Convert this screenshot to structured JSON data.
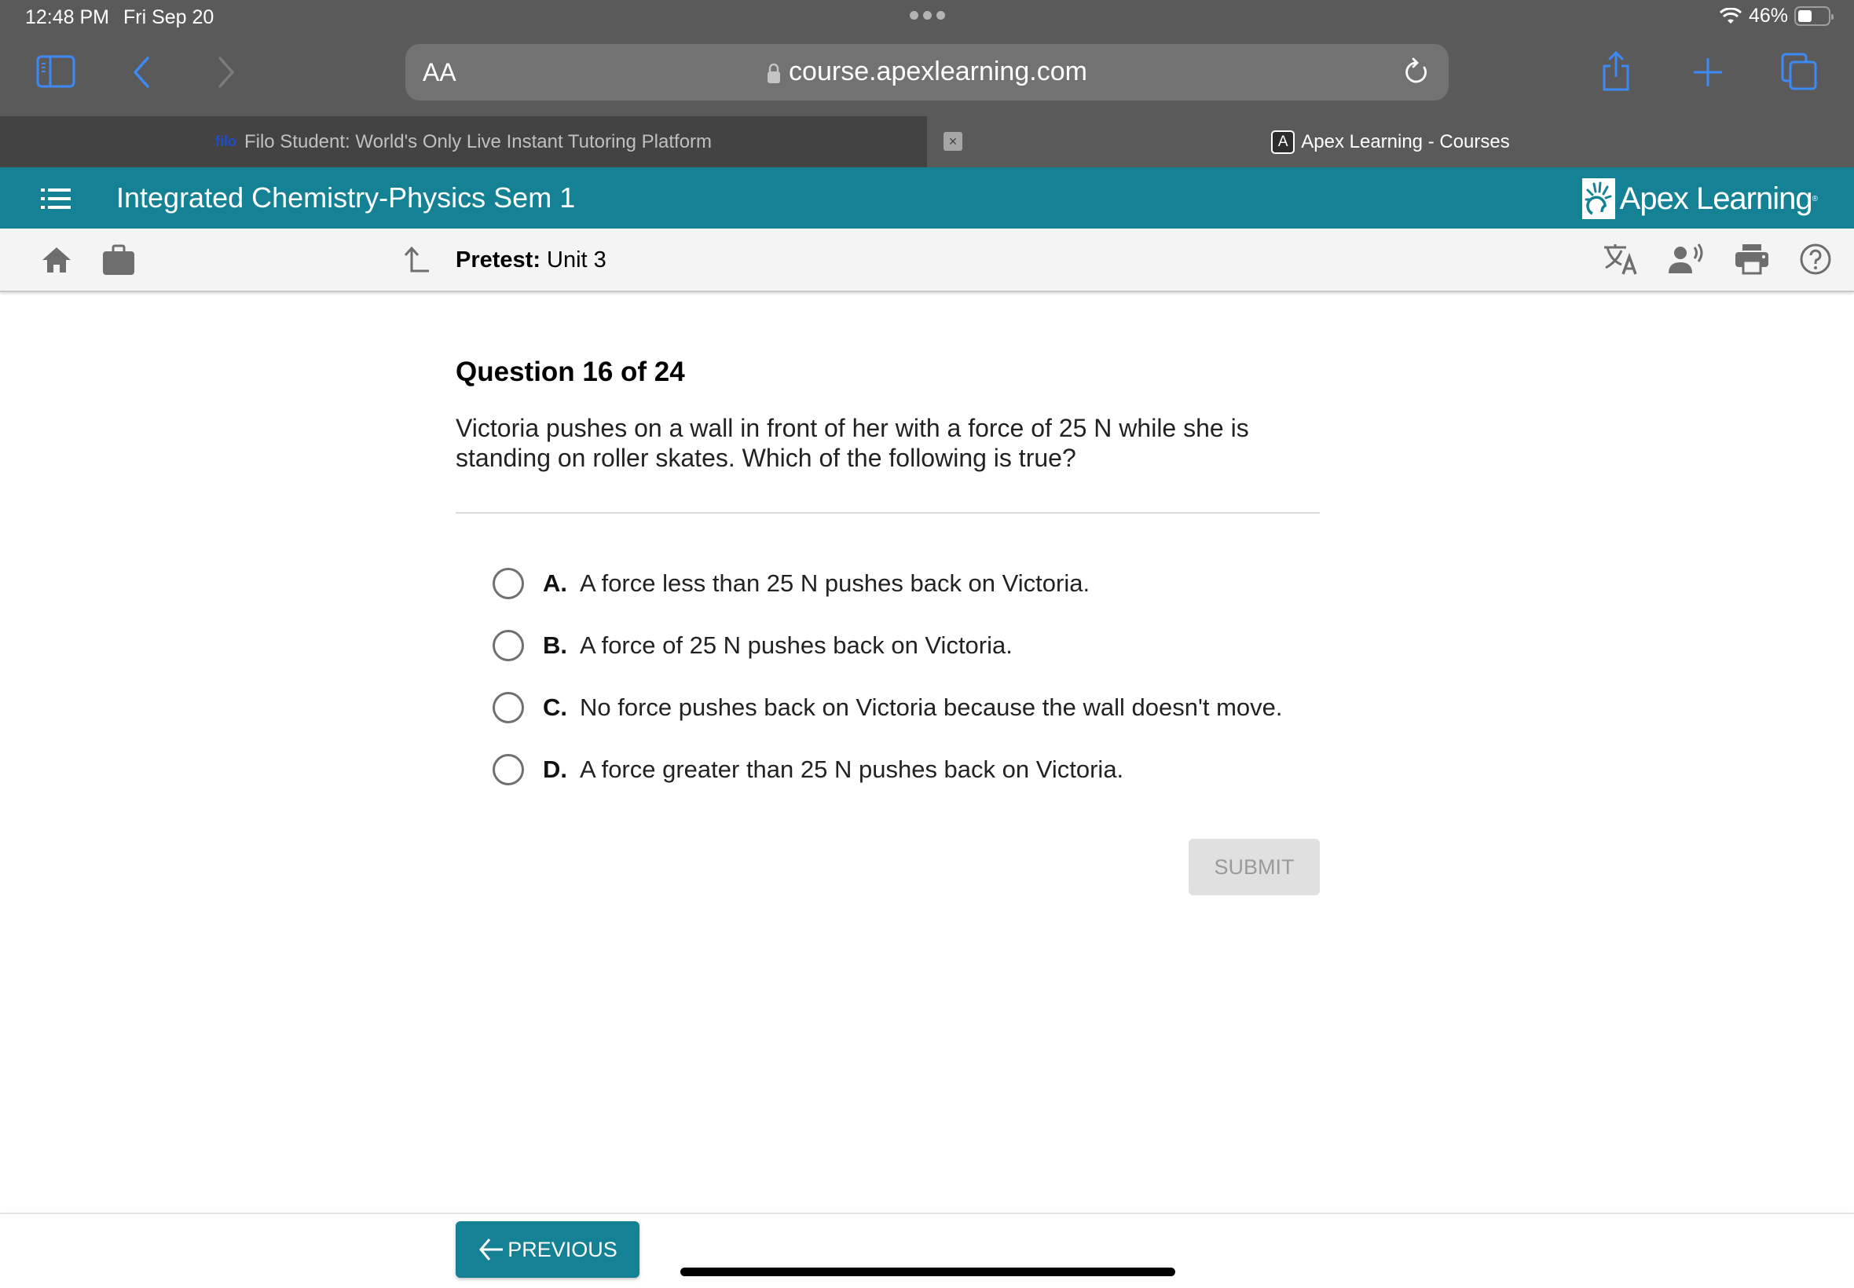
{
  "status_bar": {
    "time": "12:48 PM",
    "date": "Fri Sep 20",
    "battery_percent": "46%",
    "battery_level": 0.46
  },
  "browser": {
    "text_size_label": "AA",
    "url": "course.apexlearning.com",
    "tabs": [
      {
        "label": "Filo Student: World's Only Live Instant Tutoring Platform",
        "favicon": "filo",
        "active": false
      },
      {
        "label": "Apex Learning - Courses",
        "favicon": "A",
        "active": true
      }
    ],
    "tab_close_label": "×"
  },
  "header": {
    "course_title": "Integrated Chemistry-Physics Sem 1",
    "brand": "Apex Learning",
    "brand_color": "#148294"
  },
  "subbar": {
    "section_label": "Pretest:",
    "section_value": "Unit 3",
    "tools": [
      "translate-icon",
      "read-aloud-icon",
      "print-icon",
      "help-icon"
    ]
  },
  "question": {
    "title": "Question 16 of 24",
    "text": "Victoria pushes on a wall in front of her with a force of 25 N while she is standing on roller skates. Which of the following is true?",
    "options": [
      {
        "letter": "A.",
        "text": "A force less than 25 N pushes back on Victoria."
      },
      {
        "letter": "B.",
        "text": "A force of 25 N pushes back on Victoria."
      },
      {
        "letter": "C.",
        "text": "No force pushes back on Victoria because the wall doesn't move."
      },
      {
        "letter": "D.",
        "text": "A force greater than 25 N pushes back on Victoria."
      }
    ],
    "submit_label": "SUBMIT"
  },
  "footer": {
    "previous_label": "PREVIOUS"
  }
}
